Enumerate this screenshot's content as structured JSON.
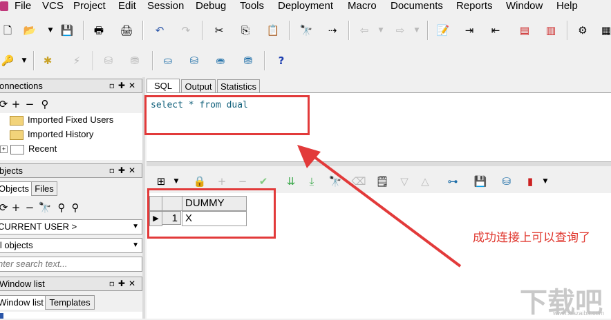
{
  "menu": [
    "File",
    "VCS",
    "Project",
    "Edit",
    "Session",
    "Debug",
    "Tools",
    "Deployment",
    "Macro",
    "Documents",
    "Reports",
    "Window",
    "Help"
  ],
  "left": {
    "connections": {
      "title": "onnections",
      "items": [
        "Imported Fixed Users",
        "Imported History",
        "Recent"
      ]
    },
    "objects": {
      "title": "bjects",
      "tabs": [
        "Objects",
        "Files"
      ],
      "user_select": "CURRENT USER >",
      "type_select": "ll objects",
      "search_placeholder": "nter search text..."
    },
    "window_list": {
      "title": "Window list",
      "tabs": [
        "Window list",
        "Templates"
      ]
    }
  },
  "editor": {
    "tabs": [
      "SQL",
      "Output",
      "Statistics"
    ],
    "code": "select * from dual"
  },
  "grid": {
    "column": "DUMMY",
    "rows": [
      {
        "num": "1",
        "value": "X"
      }
    ]
  },
  "annotation": "成功连接上可以查询了",
  "watermark": "下载吧",
  "watermark_sub": "www.xiazaiba.com",
  "colors": {
    "annotation_red": "#e23a3a",
    "code_text": "#0f5f7a"
  }
}
